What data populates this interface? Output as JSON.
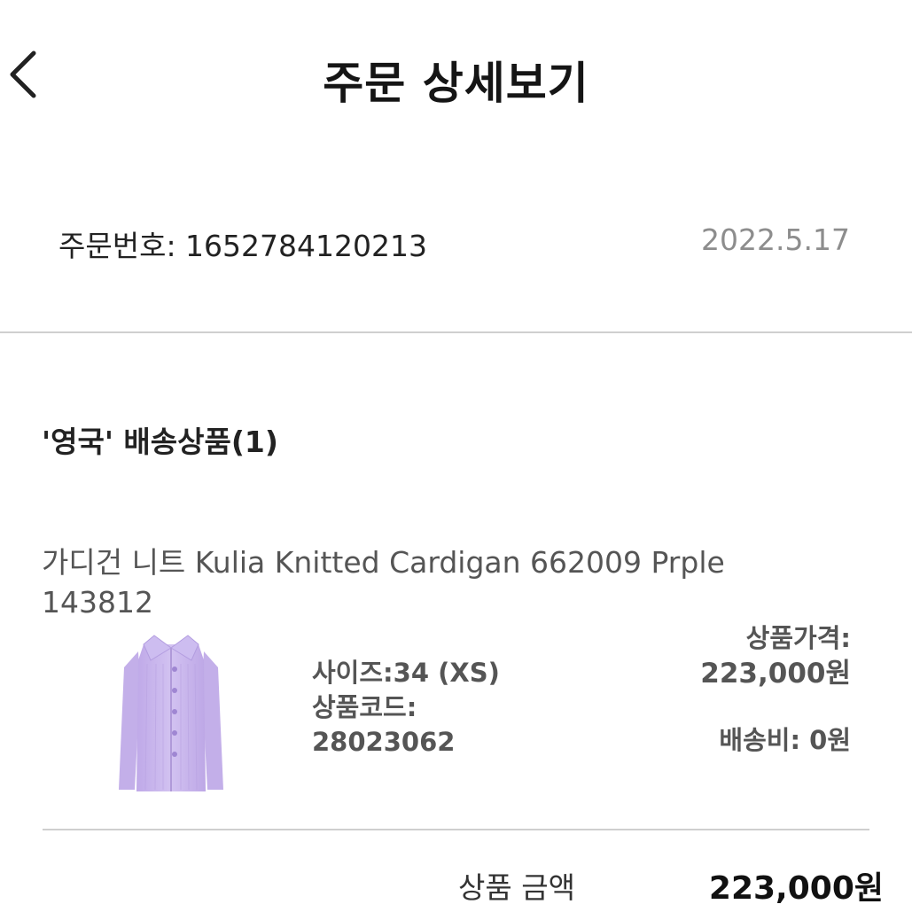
{
  "header": {
    "title": "주문 상세보기",
    "back_icon": "chevron-left-icon"
  },
  "order": {
    "number_text": "주문번호: 1652784120213",
    "date": "2022.5.17"
  },
  "shipping_group": {
    "label": "'영국' 배송상품(1)"
  },
  "product": {
    "name": "가디건 니트 Kulia Knitted Cardigan 662009 Prple 143812",
    "image": "purple-knit-cardigan",
    "size_text": "사이즈:34 (XS)",
    "code_label": "상품코드:",
    "code_value": "28023062",
    "price_label": "상품가격:",
    "price_value": "223,000원",
    "shipping_fee_text": "배송비: 0원"
  },
  "summary": {
    "total_label": "상품 금액",
    "total_value": "223,000원"
  },
  "colors": {
    "cardigan": "#c9b6ec",
    "divider": "#cfcfcf",
    "muted_text": "#8d8d8d"
  }
}
